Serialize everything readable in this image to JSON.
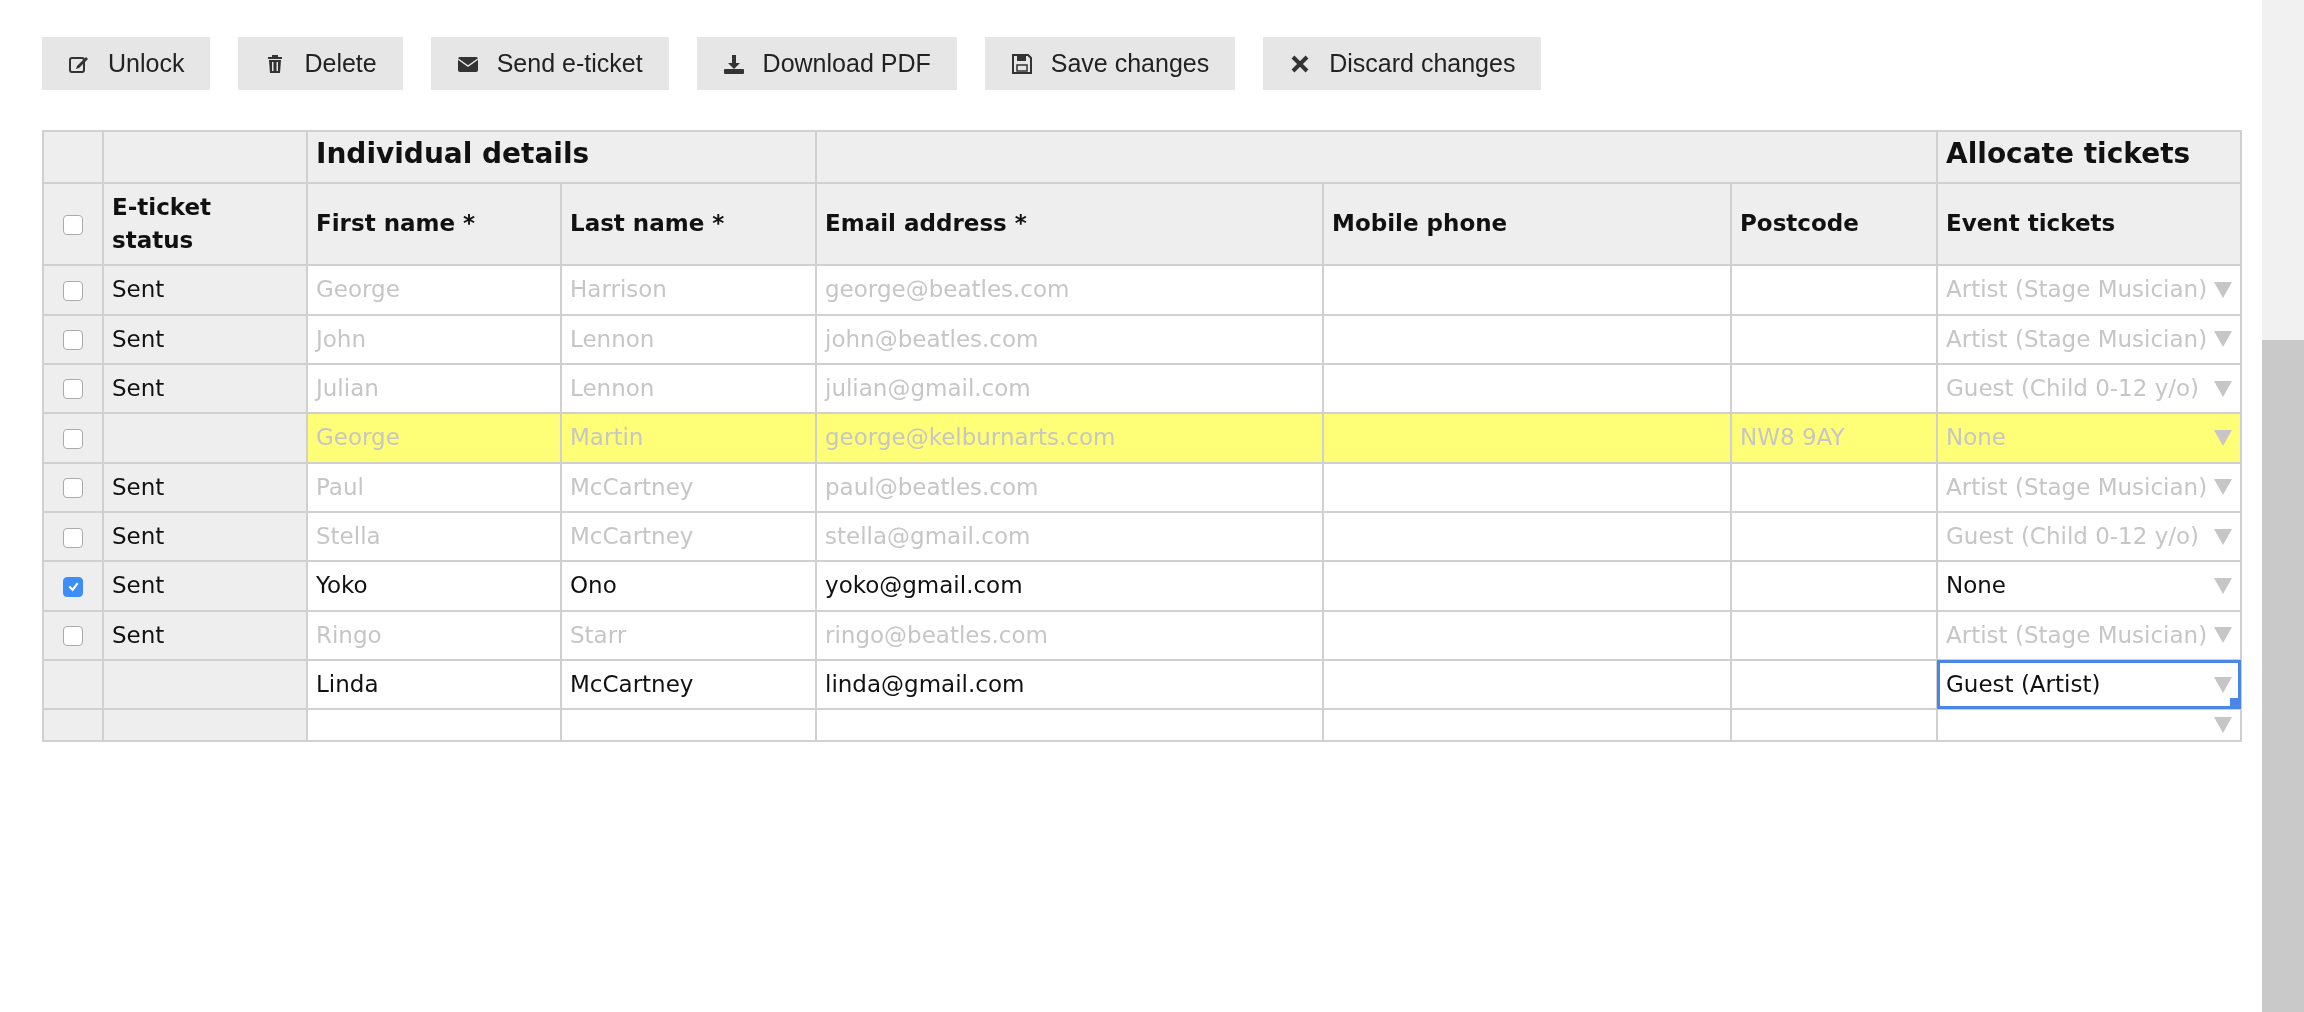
{
  "toolbar": [
    {
      "label": "Unlock"
    },
    {
      "label": "Delete"
    },
    {
      "label": "Send e-ticket"
    },
    {
      "label": "Download PDF"
    },
    {
      "label": "Save changes"
    },
    {
      "label": "Discard changes"
    }
  ],
  "table": {
    "group_headers": {
      "individual": "Individual details",
      "allocate": "Allocate tickets"
    },
    "select_all_checked": false,
    "columns": [
      "E-ticket status",
      "First name *",
      "Last name *",
      "Email address *",
      "Mobile phone",
      "Postcode",
      "Event tickets"
    ],
    "rows": [
      {
        "kind": "entry",
        "checked": false,
        "status": "Sent",
        "first_name": "George",
        "last_name": "Harrison",
        "email": "george@beatles.com",
        "ticket": "Artist (Stage Musician)",
        "locked": true,
        "highlighted": false,
        "ticket_focused": false
      },
      {
        "kind": "entry",
        "checked": false,
        "status": "Sent",
        "first_name": "John",
        "last_name": "Lennon",
        "email": "john@beatles.com",
        "ticket": "Artist (Stage Musician)",
        "locked": true,
        "highlighted": false,
        "ticket_focused": false
      },
      {
        "kind": "entry",
        "checked": false,
        "status": "Sent",
        "first_name": "Julian",
        "last_name": "Lennon",
        "email": "julian@gmail.com",
        "ticket": "Guest (Child 0-12 y/o)",
        "locked": true,
        "highlighted": false,
        "ticket_focused": false
      },
      {
        "kind": "entry",
        "checked": false,
        "first_name": "George",
        "last_name": "Martin",
        "email": "george@kelburnarts.com",
        "postcode": "NW8 9AY",
        "ticket": "None",
        "locked": true,
        "highlighted": true,
        "ticket_focused": false
      },
      {
        "kind": "entry",
        "checked": false,
        "status": "Sent",
        "first_name": "Paul",
        "last_name": "McCartney",
        "email": "paul@beatles.com",
        "ticket": "Artist (Stage Musician)",
        "locked": true,
        "highlighted": false,
        "ticket_focused": false
      },
      {
        "kind": "entry",
        "checked": false,
        "status": "Sent",
        "first_name": "Stella",
        "last_name": "McCartney",
        "email": "stella@gmail.com",
        "ticket": "Guest (Child 0-12 y/o)",
        "locked": true,
        "highlighted": false,
        "ticket_focused": false
      },
      {
        "kind": "entry",
        "checked": true,
        "status": "Sent",
        "first_name": "Yoko",
        "last_name": "Ono",
        "email": "yoko@gmail.com",
        "ticket": "None",
        "locked": false,
        "highlighted": false,
        "ticket_focused": false
      },
      {
        "kind": "entry",
        "checked": false,
        "status": "Sent",
        "first_name": "Ringo",
        "last_name": "Starr",
        "email": "ringo@beatles.com",
        "ticket": "Artist (Stage Musician)",
        "locked": true,
        "highlighted": false,
        "ticket_focused": false
      },
      {
        "kind": "new",
        "first_name": "Linda",
        "last_name": "McCartney",
        "email": "linda@gmail.com",
        "ticket": "Guest (Artist)",
        "locked": false,
        "highlighted": false,
        "ticket_focused": true
      },
      {
        "kind": "new",
        "highlighted": false,
        "ticket_focused": false
      }
    ]
  }
}
